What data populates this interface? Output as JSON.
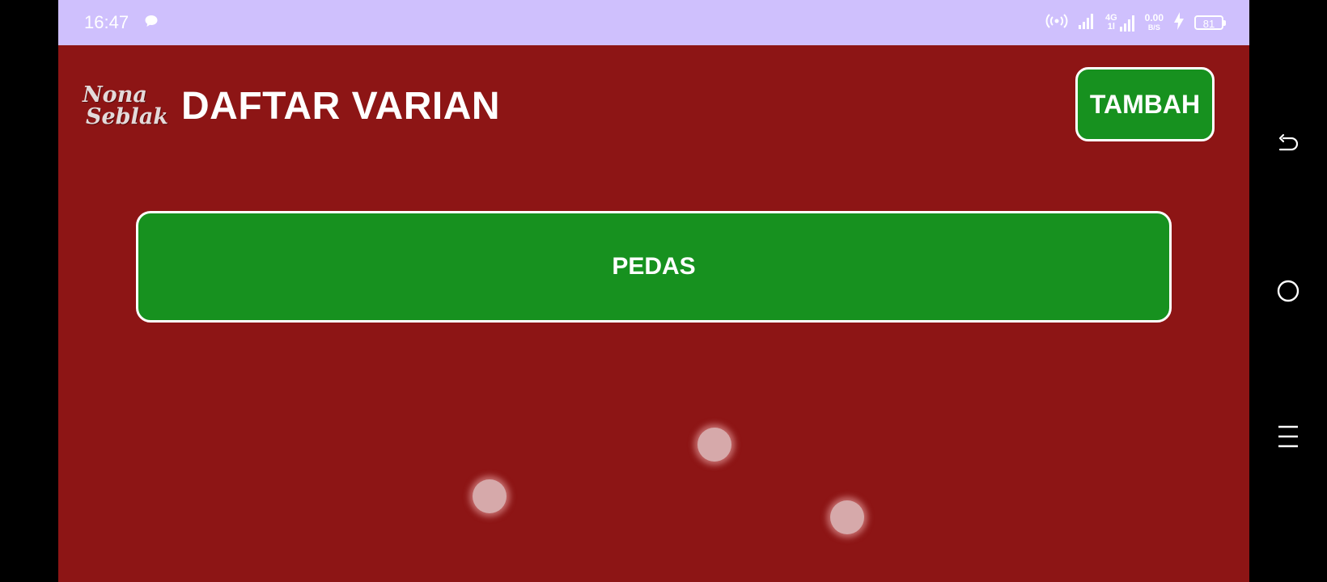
{
  "status_bar": {
    "time": "16:47",
    "network_type": "4G",
    "network_sub": "1l",
    "speed_value": "0.00",
    "speed_unit": "B/S",
    "battery": "81",
    "icons": [
      "chat-bubble-icon",
      "hotspot-icon",
      "signal-icon",
      "signal-4g-icon",
      "charging-icon",
      "battery-icon"
    ]
  },
  "header": {
    "logo_line1": "Nona",
    "logo_line2": "Seblak",
    "title": "DAFTAR VARIAN",
    "add_button": "TAMBAH"
  },
  "variants": [
    {
      "label": "PEDAS"
    }
  ],
  "nav_bar": {
    "icons": [
      "back-icon",
      "home-icon",
      "menu-icon"
    ]
  },
  "colors": {
    "status_bar": "#cfc0fd",
    "background": "#8d1515",
    "button": "#17911f",
    "border": "#ffffff"
  }
}
